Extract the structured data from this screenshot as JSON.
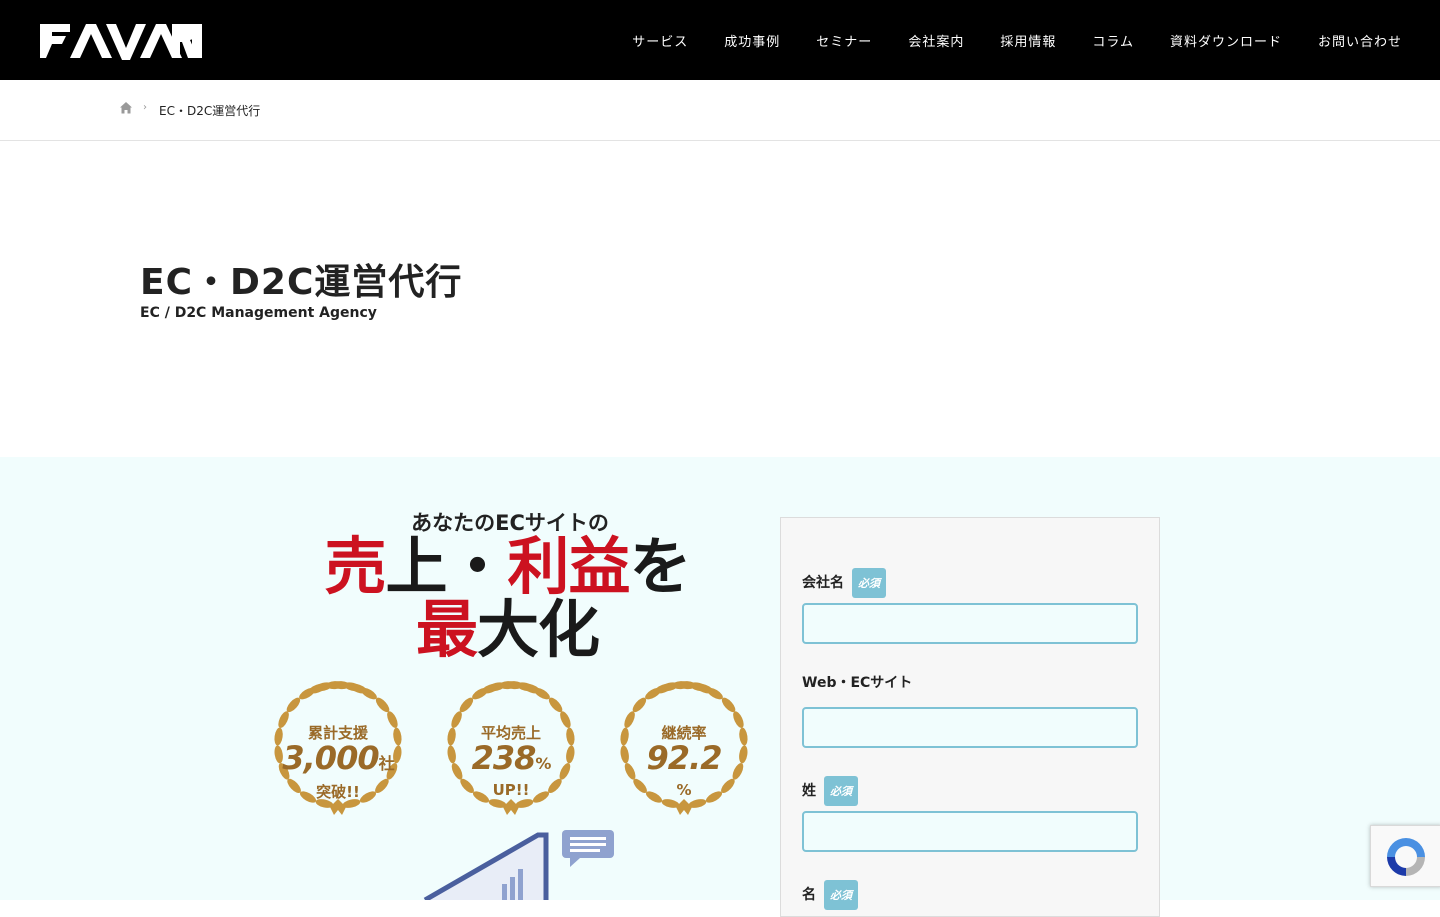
{
  "header": {
    "logo_alt": "FAVARI",
    "nav": [
      "サービス",
      "成功事例",
      "セミナー",
      "会社案内",
      "採用情報",
      "コラム",
      "資料ダウンロード",
      "お問い合わせ"
    ]
  },
  "breadcrumb": {
    "separator": "›",
    "current": "EC・D2C運営代行"
  },
  "page": {
    "title": "EC・D2C運営代行",
    "subtitle": "EC / D2C Management Agency"
  },
  "hero": {
    "lead": "あなたのECサイトの",
    "line1": [
      {
        "text": "売",
        "color": "red"
      },
      {
        "text": "上・",
        "color": "dark"
      },
      {
        "text": "利益",
        "color": "red"
      },
      {
        "text": "を",
        "color": "dark"
      }
    ],
    "line2": [
      {
        "text": "最",
        "color": "red"
      },
      {
        "text": "大化",
        "color": "dark"
      }
    ],
    "badges": [
      {
        "top": "累計支援",
        "value": "3,000",
        "unit": "社",
        "bottom": "突破!!"
      },
      {
        "top": "平均売上",
        "value": "238",
        "unit": "%",
        "bottom": "UP!!"
      },
      {
        "top": "継続率",
        "value": "92.2",
        "unit": "",
        "bottom": "%"
      }
    ]
  },
  "form": {
    "required_label": "必須",
    "fields": [
      {
        "label": "会社名",
        "required": true,
        "value": ""
      },
      {
        "label": "Web・ECサイト",
        "required": false,
        "value": ""
      },
      {
        "label": "姓",
        "required": true,
        "value": ""
      },
      {
        "label": "名",
        "required": true,
        "value": ""
      }
    ]
  },
  "colors": {
    "header_bg": "#000000",
    "accent_red": "#cc1220",
    "hero_bg": "#f1fdfd",
    "input_border": "#7ec2d5",
    "badge_gold": "#c8963e"
  }
}
